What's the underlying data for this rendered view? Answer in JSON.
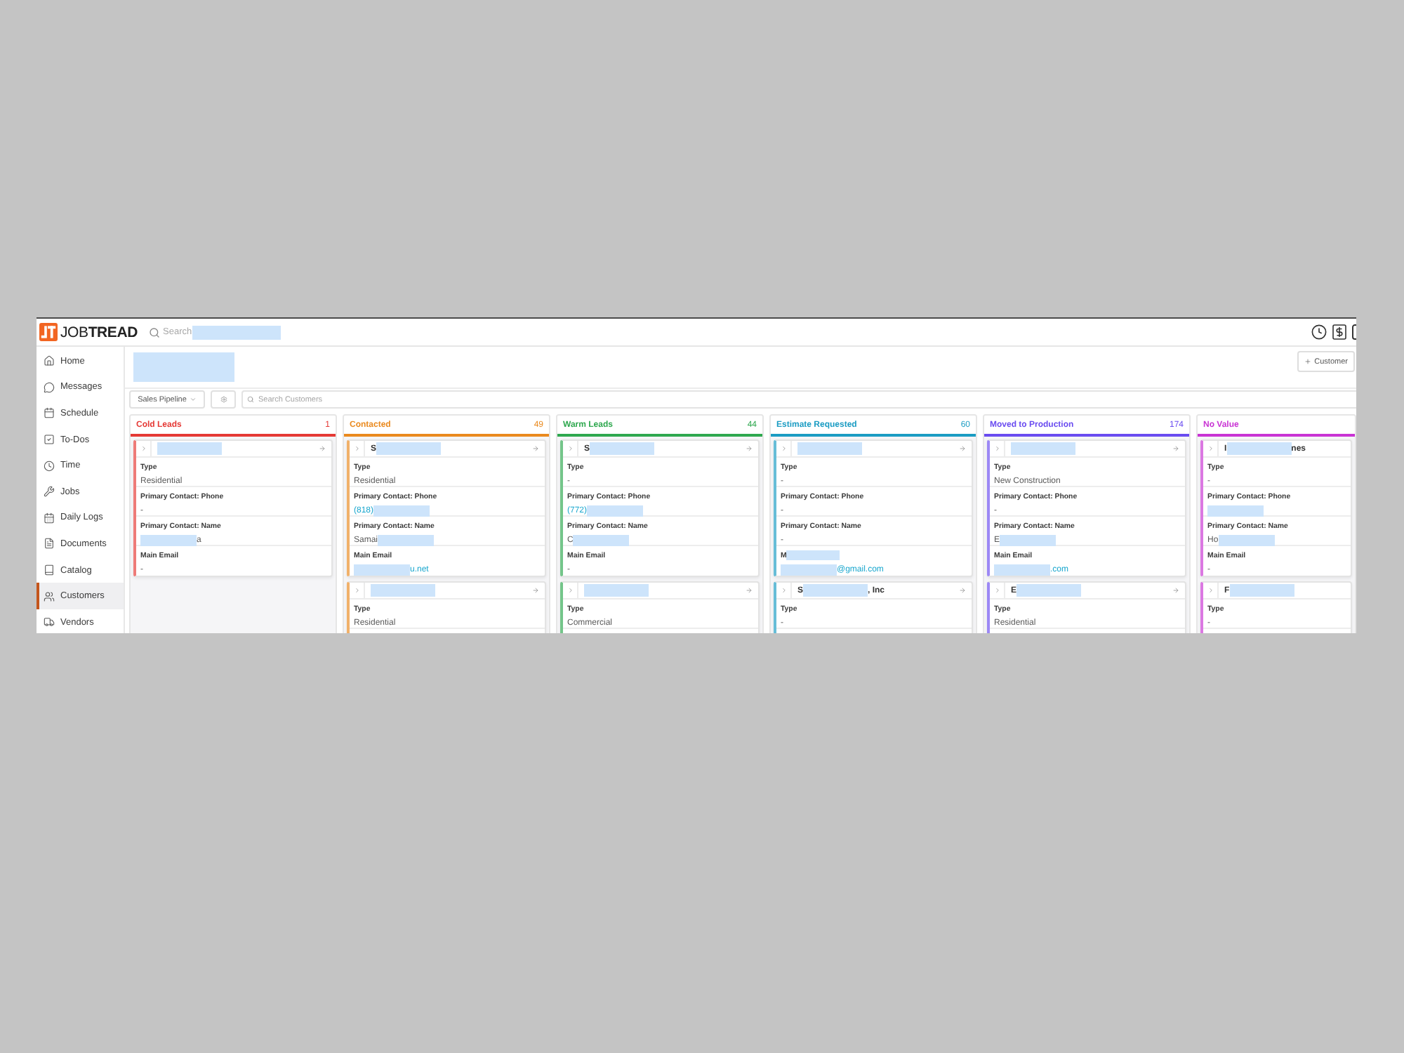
{
  "topbar": {
    "logo": "JOB**TREAD**",
    "search": {
      "placeholder": "Search",
      "redacted": true
    }
  },
  "sidebar": {
    "items": [
      {
        "label": "Home",
        "selected": false
      },
      {
        "label": "Messages",
        "selected": false
      },
      {
        "label": "Schedule",
        "selected": false
      },
      {
        "label": "To-Dos",
        "selected": false
      },
      {
        "label": "Time",
        "selected": false
      },
      {
        "label": "Jobs",
        "selected": false
      },
      {
        "label": "Daily Logs",
        "selected": false
      },
      {
        "label": "Documents",
        "selected": false
      },
      {
        "label": "Catalog",
        "selected": false
      },
      {
        "label": "Customers",
        "selected": true
      },
      {
        "label": "Vendors",
        "selected": false
      }
    ]
  },
  "header": {
    "title_redacted": true,
    "add_button": "Customer"
  },
  "toolbar": {
    "view_menu": "Sales Pipeline",
    "search": {
      "placeholder": "Search Customers"
    }
  },
  "columns": [
    {
      "title": "Cold Leads",
      "count": "1",
      "color": "#e53935",
      "cards": [
        {
          "name": [
            {
              "kind": "redaction"
            }
          ],
          "arrow": true,
          "fields": [
            {
              "label": "Type",
              "value": [
                {
                  "kind": "text",
                  "text": "Residential"
                }
              ]
            },
            {
              "label": "Primary Contact: Phone",
              "value": [
                {
                  "kind": "text",
                  "text": "-"
                }
              ]
            },
            {
              "label": "Primary Contact: Name",
              "value": [
                {
                  "kind": "redaction"
                },
                {
                  "kind": "text",
                  "text": "a"
                }
              ]
            },
            {
              "label": "Main Email",
              "value": [
                {
                  "kind": "text",
                  "text": "-"
                }
              ]
            }
          ]
        }
      ]
    },
    {
      "title": "Contacted",
      "count": "49",
      "color": "#ea8a1f",
      "cards": [
        {
          "name": [
            {
              "kind": "text",
              "text": "S"
            },
            {
              "kind": "redaction"
            }
          ],
          "arrow": true,
          "fields": [
            {
              "label": "Type",
              "value": [
                {
                  "kind": "text",
                  "text": "Residential"
                }
              ]
            },
            {
              "label": "Primary Contact: Phone",
              "value": [
                {
                  "kind": "link",
                  "text": "(818)"
                },
                {
                  "kind": "redaction"
                }
              ]
            },
            {
              "label": "Primary Contact: Name",
              "value": [
                {
                  "kind": "text",
                  "text": "Samai"
                },
                {
                  "kind": "redaction"
                }
              ]
            },
            {
              "label": "Main Email",
              "value": [
                {
                  "kind": "redaction"
                },
                {
                  "kind": "link",
                  "text": "u.net"
                }
              ]
            }
          ]
        },
        {
          "name": [
            {
              "kind": "redaction"
            }
          ],
          "arrow": true,
          "fields": [
            {
              "label": "Type",
              "value": [
                {
                  "kind": "text",
                  "text": "Residential"
                }
              ]
            }
          ]
        }
      ]
    },
    {
      "title": "Warm Leads",
      "count": "44",
      "color": "#2fa84f",
      "cards": [
        {
          "name": [
            {
              "kind": "text",
              "text": "S"
            },
            {
              "kind": "redaction"
            }
          ],
          "arrow": true,
          "fields": [
            {
              "label": "Type",
              "value": [
                {
                  "kind": "text",
                  "text": "-"
                }
              ]
            },
            {
              "label": "Primary Contact: Phone",
              "value": [
                {
                  "kind": "link",
                  "text": "(772)"
                },
                {
                  "kind": "redaction"
                }
              ]
            },
            {
              "label": "Primary Contact: Name",
              "value": [
                {
                  "kind": "text",
                  "text": "C"
                },
                {
                  "kind": "redaction"
                }
              ]
            },
            {
              "label": "Main Email",
              "value": [
                {
                  "kind": "text",
                  "text": "-"
                }
              ]
            }
          ]
        },
        {
          "name": [
            {
              "kind": "redaction"
            }
          ],
          "arrow": true,
          "fields": [
            {
              "label": "Type",
              "value": [
                {
                  "kind": "text",
                  "text": "Commercial"
                }
              ]
            }
          ]
        }
      ]
    },
    {
      "title": "Estimate Requested",
      "count": "60",
      "color": "#1b9cc3",
      "cards": [
        {
          "name": [
            {
              "kind": "redaction"
            }
          ],
          "arrow": true,
          "fields": [
            {
              "label": "Type",
              "value": [
                {
                  "kind": "text",
                  "text": "-"
                }
              ]
            },
            {
              "label": "Primary Contact: Phone",
              "value": [
                {
                  "kind": "text",
                  "text": "-"
                }
              ]
            },
            {
              "label": "Primary Contact: Name",
              "value": [
                {
                  "kind": "text",
                  "text": "-"
                }
              ]
            },
            {
              "label": "M",
              "label_redacted": true,
              "value": [
                {
                  "kind": "redaction"
                },
                {
                  "kind": "link",
                  "text": "@gmail.com"
                }
              ]
            }
          ]
        },
        {
          "name": [
            {
              "kind": "text",
              "text": "S"
            },
            {
              "kind": "redaction"
            },
            {
              "kind": "text",
              "text": ", Inc"
            }
          ],
          "arrow": true,
          "fields": [
            {
              "label": "Type",
              "value": [
                {
                  "kind": "text",
                  "text": "-"
                }
              ]
            }
          ]
        }
      ]
    },
    {
      "title": "Moved to Production",
      "count": "174",
      "color": "#6a4cf0",
      "cards": [
        {
          "name": [
            {
              "kind": "redaction"
            }
          ],
          "arrow": true,
          "fields": [
            {
              "label": "Type",
              "value": [
                {
                  "kind": "text",
                  "text": "New Construction"
                }
              ]
            },
            {
              "label": "Primary Contact: Phone",
              "value": [
                {
                  "kind": "text",
                  "text": "-"
                }
              ]
            },
            {
              "label": "Primary Contact: Name",
              "value": [
                {
                  "kind": "text",
                  "text": "E"
                },
                {
                  "kind": "redaction"
                }
              ]
            },
            {
              "label": "Main Email",
              "value": [
                {
                  "kind": "redaction"
                },
                {
                  "kind": "link",
                  "text": ".com"
                }
              ]
            }
          ]
        },
        {
          "name": [
            {
              "kind": "text",
              "text": "E"
            },
            {
              "kind": "redaction"
            }
          ],
          "arrow": true,
          "fields": [
            {
              "label": "Type",
              "value": [
                {
                  "kind": "text",
                  "text": "Residential"
                }
              ]
            }
          ]
        }
      ]
    },
    {
      "title": "No Value",
      "color": "#c934d4",
      "cards": [
        {
          "name": [
            {
              "kind": "text",
              "text": "I"
            },
            {
              "kind": "redaction"
            },
            {
              "kind": "text",
              "text": "nes"
            }
          ],
          "arrow": false,
          "fields": [
            {
              "label": "Type",
              "value": [
                {
                  "kind": "text",
                  "text": "-"
                }
              ]
            },
            {
              "label": "Primary Contact: Phone",
              "value": [
                {
                  "kind": "redaction"
                }
              ]
            },
            {
              "label": "Primary Contact: Name",
              "value": [
                {
                  "kind": "text",
                  "text": "Ho"
                },
                {
                  "kind": "redaction"
                }
              ]
            },
            {
              "label": "Main Email",
              "value": [
                {
                  "kind": "text",
                  "text": "-"
                }
              ]
            }
          ]
        },
        {
          "name": [
            {
              "kind": "text",
              "text": "F"
            },
            {
              "kind": "redaction"
            }
          ],
          "arrow": false,
          "fields": [
            {
              "label": "Type",
              "value": [
                {
                  "kind": "text",
                  "text": "-"
                }
              ]
            }
          ]
        }
      ]
    }
  ]
}
